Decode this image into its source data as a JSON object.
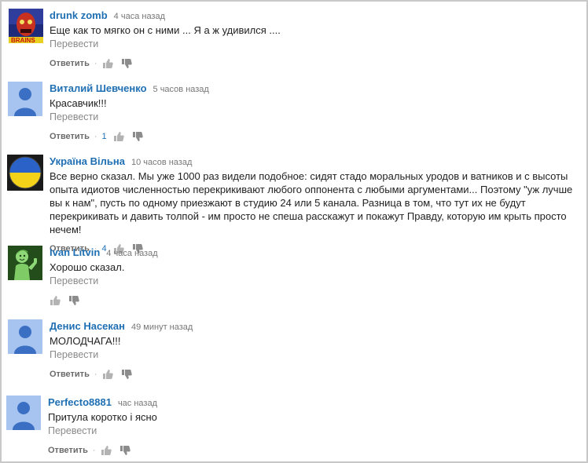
{
  "translate_label": "Перевести",
  "reply_label": "Ответить",
  "comments": [
    {
      "author": "drunk zomb",
      "time": "4 часа назад",
      "text": "Еще как то мягко он с ними ... Я а ж удивился ....",
      "likes": "",
      "avatar": "zombie-art-avatar"
    },
    {
      "author": "Виталий Шевченко",
      "time": "5 часов назад",
      "text": "Красавчик!!!",
      "likes": "1",
      "avatar": "default-user-avatar"
    },
    {
      "author": "Україна Вільна",
      "time": "10 часов назад",
      "text": "Все верно сказал. Мы уже 1000 раз видели подобное: сидят стадо моральных уродов и ватников и с высоты опыта идиотов численностью перекрикивают любого оппонента с любыми аргументами... Поэтому \"уж лучше вы к нам\", пусть по одному приезжают в студию 24 или 5 канала. Разница в том, что тут их не будут перекрикивать и давить толпой - им просто не спеша расскажут и покажут Правду, которую им крыть просто нечем!",
      "likes": "4",
      "avatar": "ukraine-flag-avatar"
    },
    {
      "author": "Ivan Litvin",
      "time": "4 часа назад",
      "text": "Хорошо сказал.",
      "likes": "",
      "avatar": "vault-boy-avatar"
    },
    {
      "author": "Денис Насекан",
      "time": "49 минут назад",
      "text": "МОЛОДЧАГА!!!",
      "likes": "",
      "avatar": "default-user-avatar"
    },
    {
      "author": "Perfecto8881",
      "time": "час назад",
      "text": "Притула коротко і ясно",
      "likes": "",
      "avatar": "default-user-avatar"
    }
  ],
  "colors": {
    "author": "#1f6fb3",
    "default_avatar_bg": "#a6c4ef",
    "default_avatar_fg": "#3b6fc4"
  }
}
